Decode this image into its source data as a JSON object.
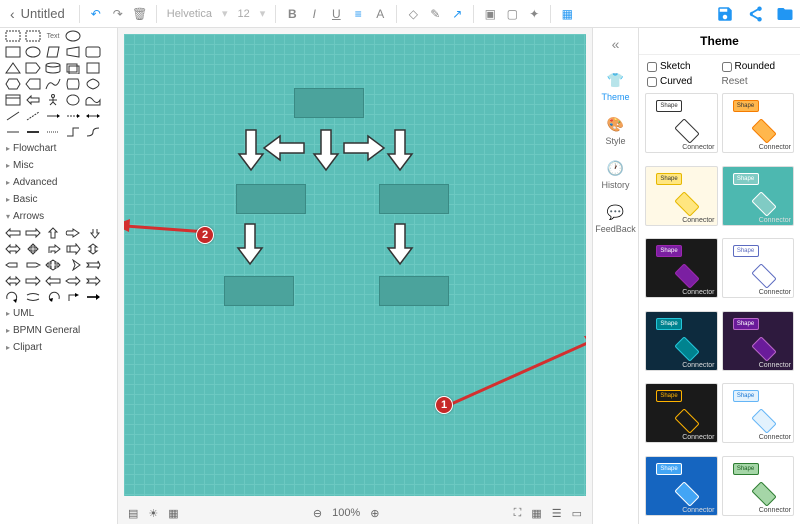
{
  "header": {
    "title": "Untitled",
    "font": "Helvetica",
    "fontSize": "12"
  },
  "leftCategories": {
    "flowchart": "Flowchart",
    "misc": "Misc",
    "advanced": "Advanced",
    "basic": "Basic",
    "arrows": "Arrows",
    "uml": "UML",
    "bpmn": "BPMN General",
    "clipart": "Clipart"
  },
  "rail": {
    "theme": "Theme",
    "style": "Style",
    "history": "History",
    "feedback": "FeedBack"
  },
  "themePanel": {
    "title": "Theme",
    "sketch": "Sketch",
    "rounded": "Rounded",
    "curved": "Curved",
    "reset": "Reset",
    "shape": "Shape",
    "connector": "Connector"
  },
  "status": {
    "zoom": "100%"
  },
  "badges": {
    "one": "1",
    "two": "2"
  }
}
